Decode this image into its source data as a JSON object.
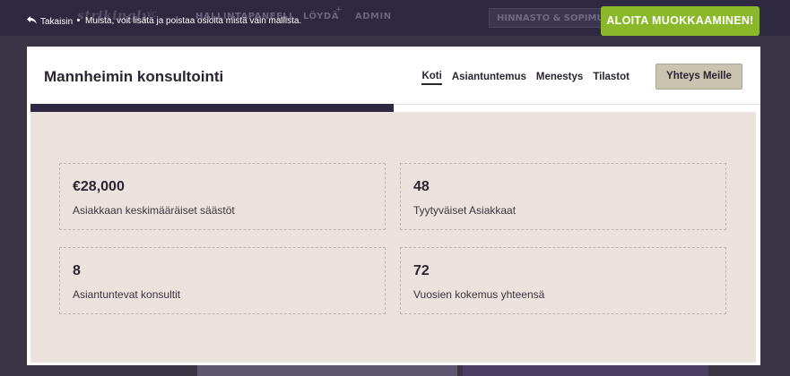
{
  "editor_bar": {
    "logo": "strikingly",
    "logo_sub": "VC",
    "nav": [
      "HALLINTAPANEELI",
      "LÖYDÄ",
      "ADMIN"
    ],
    "pricing": "HINNASTO & SOPIMUK",
    "back_label": "Takaisin",
    "tip": "Muista, voit lisätä ja poistaa osioita mistä vain mallista.",
    "start_edit_label": "ALOITA MUOKKAAMINEN!",
    "accent_color": "#8ab82a"
  },
  "site": {
    "title": "Mannheimin konsultointi",
    "nav": [
      {
        "label": "Koti",
        "active": true
      },
      {
        "label": "Asiantuntemus",
        "active": false
      },
      {
        "label": "Menestys",
        "active": false
      },
      {
        "label": "Tilastot",
        "active": false
      }
    ],
    "contact_label": "Yhteys Meille",
    "stats": [
      {
        "value": "€28,000",
        "label": "Asiakkaan keskimääräiset säästöt"
      },
      {
        "value": "48",
        "label": "Tyytyväiset Asiakkaat"
      },
      {
        "value": "8",
        "label": "Asiantuntevat konsultit"
      },
      {
        "value": "72",
        "label": "Vuosien kokemus yhteensä"
      }
    ]
  }
}
